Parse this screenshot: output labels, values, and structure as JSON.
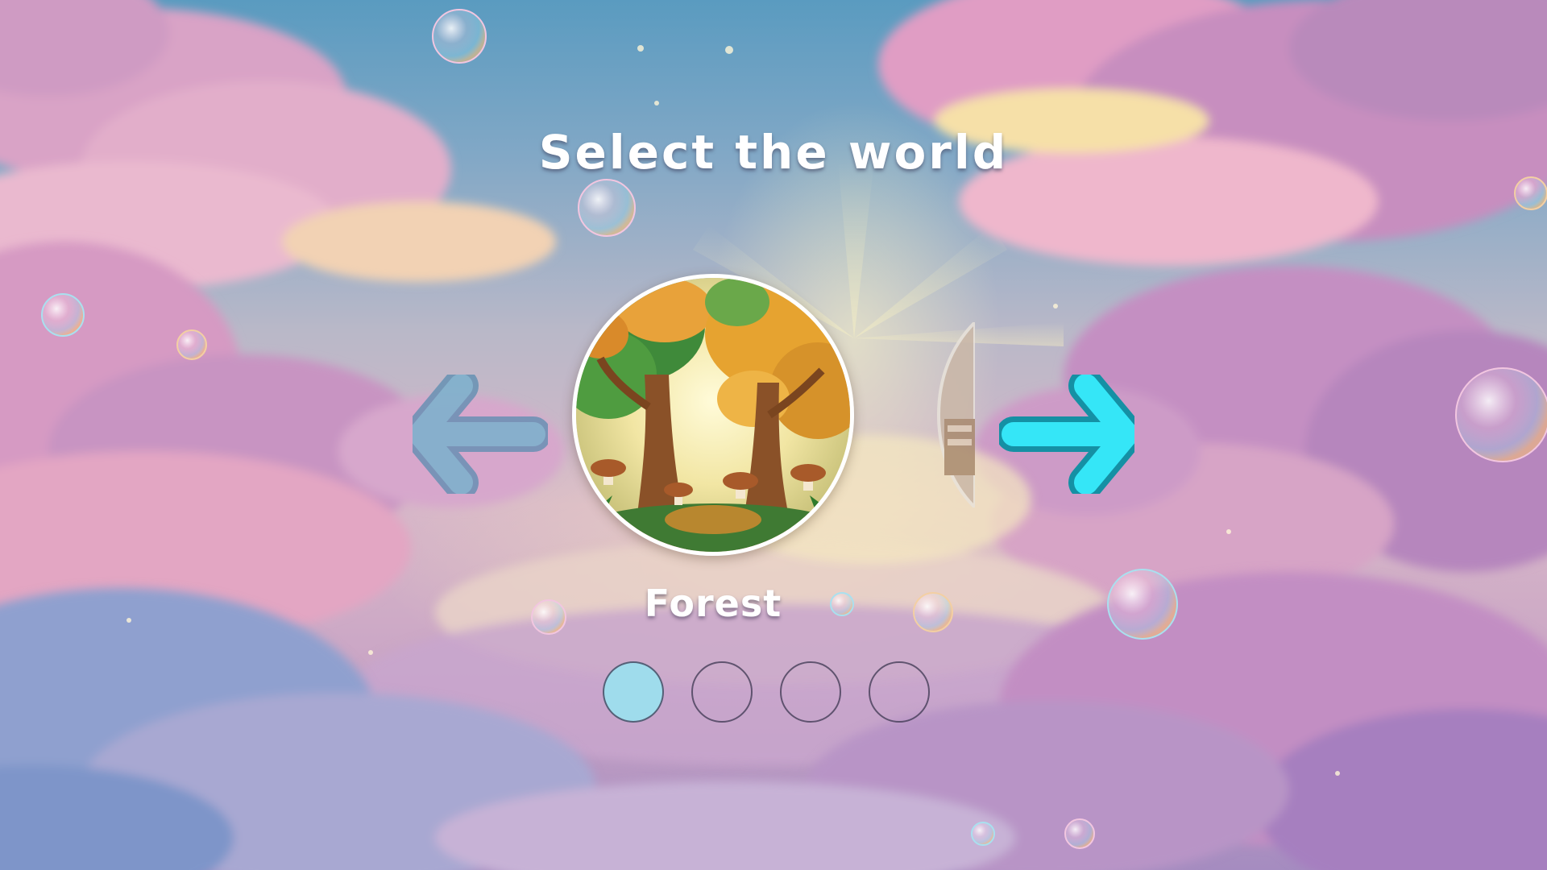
{
  "screen": {
    "title": "Select the world"
  },
  "world": {
    "current_name": "Forest"
  },
  "navigation": {
    "left_icon": "arrow-left-icon",
    "right_icon": "arrow-right-icon"
  },
  "pager": {
    "count": 4,
    "active_index": 0
  },
  "colors": {
    "right_arrow_fill": "#35e6f7",
    "right_arrow_outline": "#1590a4",
    "left_arrow_fill": "#7fb1cc",
    "left_arrow_outline": "#5c8db0",
    "active_dot": "#9fdcec"
  }
}
